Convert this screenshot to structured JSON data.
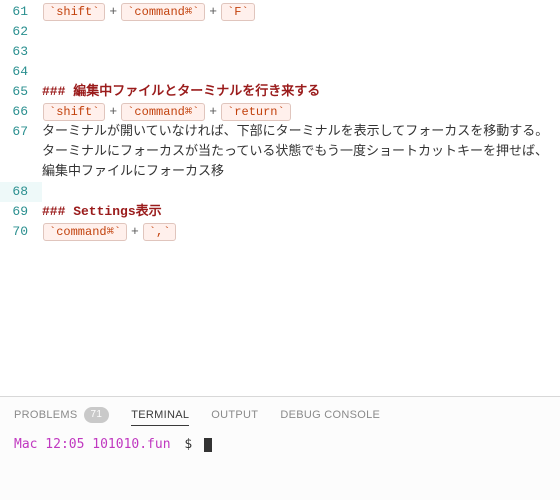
{
  "editor": {
    "lines": [
      {
        "num": 61,
        "type": "keys",
        "keys": [
          "shift",
          "command⌘",
          "F"
        ]
      },
      {
        "num": 62,
        "type": "blank"
      },
      {
        "num": 63,
        "type": "blank"
      },
      {
        "num": 64,
        "type": "blank"
      },
      {
        "num": 65,
        "type": "heading",
        "text": "### 編集中ファイルとターミナルを行き来する"
      },
      {
        "num": 66,
        "type": "keys",
        "keys": [
          "shift",
          "command⌘",
          "return"
        ]
      },
      {
        "num": 67,
        "type": "text",
        "text": "ターミナルが開いていなければ、下部にターミナルを表示してフォーカスを移動する。ターミナルにフォーカスが当たっている状態でもう一度ショートカットキーを押せば、編集中ファイルにフォーカス移"
      },
      {
        "num": 68,
        "type": "blank",
        "current": true
      },
      {
        "num": 69,
        "type": "heading",
        "text": "### Settings表示"
      },
      {
        "num": 70,
        "type": "keys",
        "keys": [
          "command⌘",
          ","
        ]
      }
    ]
  },
  "panel": {
    "tabs": {
      "problems": {
        "label": "PROBLEMS",
        "count": "71"
      },
      "terminal": {
        "label": "TERMINAL"
      },
      "output": {
        "label": "OUTPUT"
      },
      "debug": {
        "label": "DEBUG CONSOLE"
      }
    },
    "terminal": {
      "prompt": "Mac 12:05 101010.fun",
      "symbol": "$"
    }
  }
}
